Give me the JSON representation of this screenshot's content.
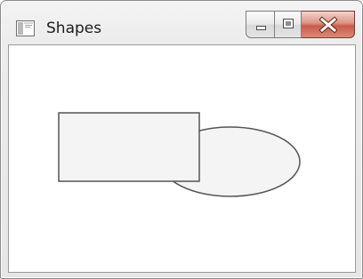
{
  "window": {
    "title": "Shapes"
  },
  "titlebar": {
    "app_icon": "window-app-icon",
    "buttons": {
      "minimize": "minimize-icon",
      "maximize": "maximize-icon",
      "close": "close-icon"
    }
  },
  "canvas": {
    "shapes": [
      {
        "kind": "ellipse",
        "fill": "#f4f4f4",
        "stroke": "#555555"
      },
      {
        "kind": "rectangle",
        "fill": "#f4f4f4",
        "stroke": "#555555"
      }
    ]
  }
}
